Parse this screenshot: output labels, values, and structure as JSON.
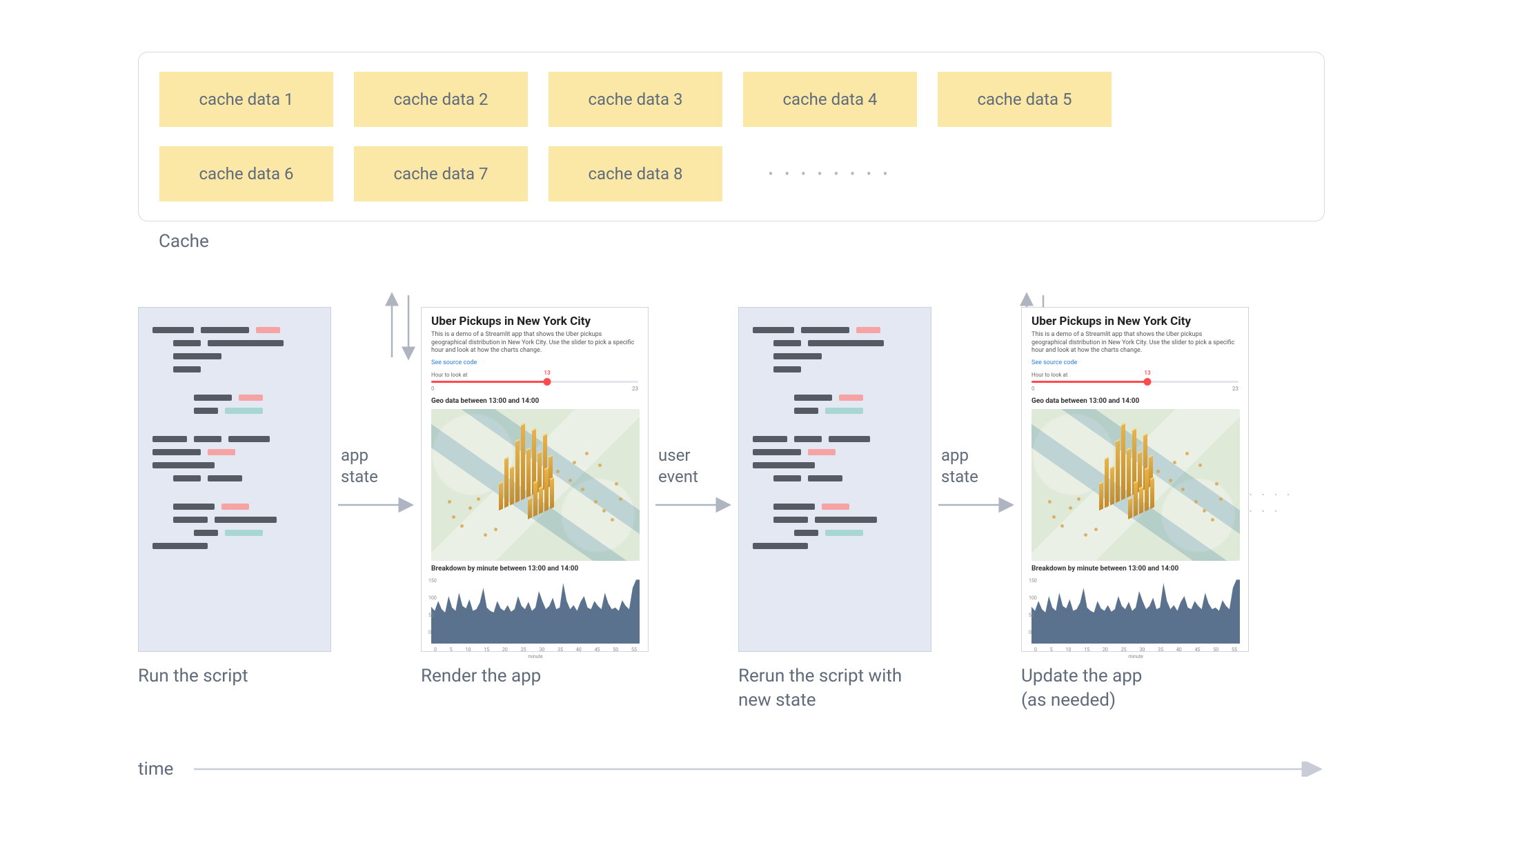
{
  "cache": {
    "label": "Cache",
    "items": [
      "cache data 1",
      "cache data 2",
      "cache data 3",
      "cache data 4",
      "cache data 5",
      "cache data 6",
      "cache data 7",
      "cache data 8"
    ]
  },
  "stages": {
    "s1": "Run the script",
    "s2": "Render the app",
    "s3": "Rerun the script with\nnew state",
    "s4": "Update the app\n(as needed)"
  },
  "arrows": {
    "a1": "app\nstate",
    "a2": "user\nevent",
    "a3": "app\nstate"
  },
  "timeline": {
    "label": "time"
  },
  "app": {
    "title": "Uber Pickups in New York City",
    "subtitle": "This is a demo of a Streamlit app that shows the Uber pickups geographical distribution in New York City. Use the slider to pick a specific hour and look at how the charts change.",
    "link": "See source code",
    "slider_label": "Hour to look at",
    "slider_value": "13",
    "slider_min": "0",
    "slider_max": "23",
    "geo_heading": "Geo data between 13:00 and 14:00",
    "breakdown_heading": "Breakdown by minute between 13:00 and 14:00",
    "x_axis_label": "minute",
    "x_ticks": [
      "0",
      "5",
      "10",
      "15",
      "20",
      "25",
      "30",
      "35",
      "40",
      "45",
      "50",
      "55"
    ],
    "y_ticks": [
      "150",
      "100",
      "50",
      "0"
    ]
  },
  "chart_data": {
    "type": "area",
    "title": "Breakdown by minute between 13:00 and 14:00",
    "xlabel": "minute",
    "ylabel": "",
    "ylim": [
      0,
      160
    ],
    "x": [
      0,
      1,
      2,
      3,
      4,
      5,
      6,
      7,
      8,
      9,
      10,
      11,
      12,
      13,
      14,
      15,
      16,
      17,
      18,
      19,
      20,
      21,
      22,
      23,
      24,
      25,
      26,
      27,
      28,
      29,
      30,
      31,
      32,
      33,
      34,
      35,
      36,
      37,
      38,
      39,
      40,
      41,
      42,
      43,
      44,
      45,
      46,
      47,
      48,
      49,
      50,
      51,
      52,
      53,
      54,
      55,
      56,
      57,
      58,
      59
    ],
    "values": [
      95,
      88,
      110,
      92,
      85,
      120,
      98,
      90,
      130,
      100,
      95,
      112,
      88,
      92,
      105,
      140,
      98,
      90,
      86,
      110,
      95,
      90,
      102,
      88,
      94,
      120,
      100,
      92,
      108,
      90,
      96,
      132,
      110,
      94,
      100,
      115,
      92,
      98,
      148,
      110,
      94,
      102,
      90,
      108,
      120,
      98,
      92,
      110,
      100,
      94,
      128,
      106,
      92,
      98,
      90,
      112,
      100,
      94,
      140,
      160
    ]
  }
}
